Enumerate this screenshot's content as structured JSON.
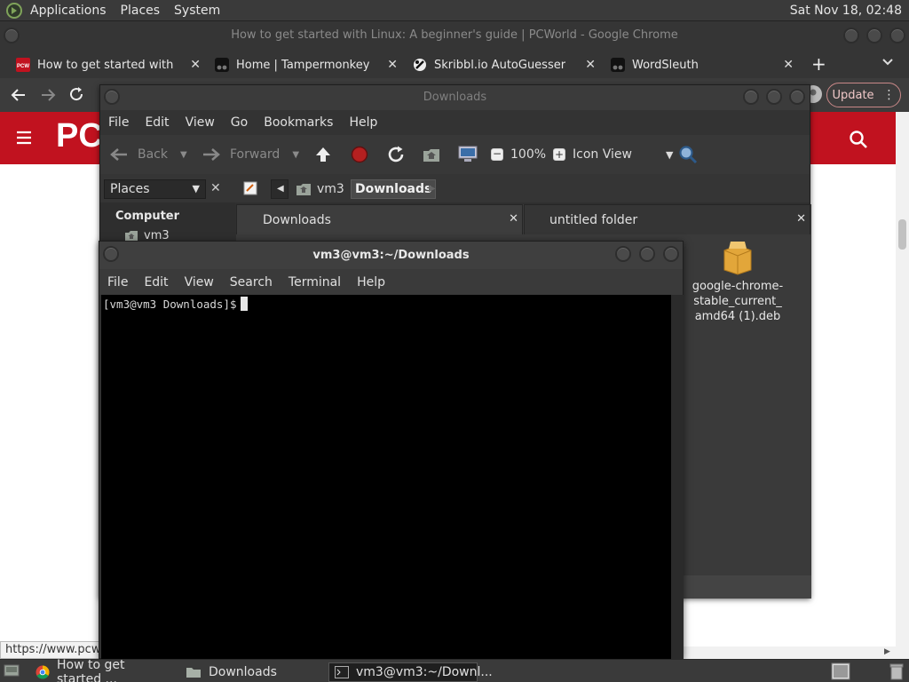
{
  "top_panel": {
    "menus": [
      "Applications",
      "Places",
      "System"
    ],
    "clock": "Sat Nov 18, 02:48"
  },
  "chrome": {
    "window_title": "How to get started with Linux: A beginner's guide | PCWorld - Google Chrome",
    "tabs": [
      {
        "title": "How to get started with Linux: A beginner's guide",
        "favicon": "pcw-favicon-icon",
        "favicon_text": "PCW"
      },
      {
        "title": "Home | Tampermonkey",
        "favicon": "tampermonkey-icon"
      },
      {
        "title": "Skribbl.io AutoGuesser",
        "favicon": "script-icon"
      },
      {
        "title": "WordSleuth",
        "favicon": "tampermonkey-icon"
      }
    ],
    "new_tab_label": "+",
    "update_label": "Update",
    "status_url": "https://www.pcworld.com/",
    "page_logo": "PCW",
    "accent": "#c1121f"
  },
  "file_manager": {
    "title": "Downloads",
    "menu": [
      "File",
      "Edit",
      "View",
      "Go",
      "Bookmarks",
      "Help"
    ],
    "toolbar": {
      "back": "Back",
      "forward": "Forward",
      "zoom": "100%",
      "view_mode": "Icon View"
    },
    "sidebar_select": "Places",
    "path": [
      "vm3",
      "Downloads"
    ],
    "sidebar": {
      "heading": "Computer",
      "items": [
        "vm3"
      ]
    },
    "tabs": [
      "Downloads",
      "untitled folder"
    ],
    "files": [
      {
        "name": "google-chrome-stable_current_amd64 (1).deb",
        "lines": [
          "google-chrome-",
          "stable_current_",
          "amd64 (1).deb"
        ]
      }
    ]
  },
  "terminal": {
    "title": "vm3@vm3:~/Downloads",
    "menu": [
      "File",
      "Edit",
      "View",
      "Search",
      "Terminal",
      "Help"
    ],
    "prompt": "[vm3@vm3 Downloads]$"
  },
  "taskbar": {
    "items": [
      {
        "label": "How to get started ...",
        "icon": "chrome-icon",
        "active": false
      },
      {
        "label": "Downloads",
        "icon": "folder-icon",
        "active": false
      },
      {
        "label": "vm3@vm3:~/Downl...",
        "icon": "terminal-icon",
        "active": true
      }
    ]
  }
}
